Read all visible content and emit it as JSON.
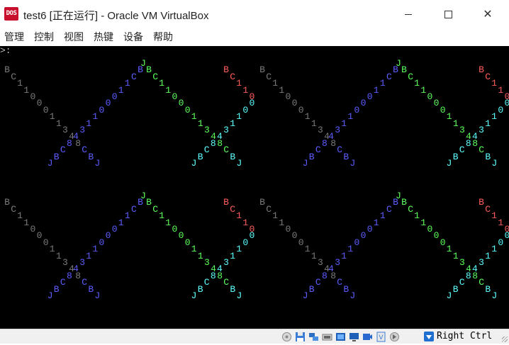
{
  "window": {
    "icon_text": "DOS",
    "title": "test6 [正在运行] - Oracle VM VirtualBox",
    "minimize_label": "",
    "close_glyph": "✕"
  },
  "menu": {
    "items": [
      "管理",
      "控制",
      "视图",
      "热键",
      "设备",
      "帮助"
    ]
  },
  "vm": {
    "prompt": ">:",
    "sequence": [
      "J",
      "B",
      "C",
      "1",
      "1",
      "0",
      "0",
      "0",
      "1",
      "1",
      "3",
      "4",
      "8",
      "C",
      "B",
      "J"
    ],
    "colors": {
      "green": "#5cff5c",
      "blue": "#5c5cff",
      "gray": "#7a7a7a",
      "red": "#ff5c5c",
      "cyan": "#5cffff"
    }
  },
  "statusbar": {
    "icons": [
      "disk-icon",
      "floppy-icon",
      "network-icon",
      "usb-icon",
      "shared-folder-icon",
      "display-icon",
      "video-capture-icon",
      "cpu-icon",
      "mouse-integration-icon"
    ],
    "host_key": "Right Ctrl"
  }
}
